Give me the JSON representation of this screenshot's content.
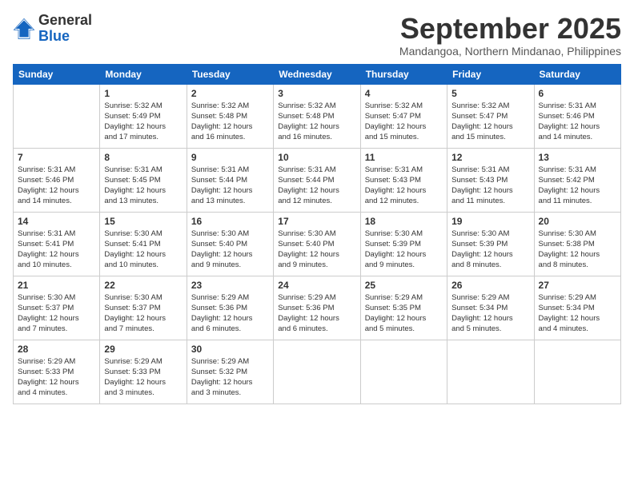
{
  "logo": {
    "general": "General",
    "blue": "Blue"
  },
  "header": {
    "month": "September 2025",
    "location": "Mandangoa, Northern Mindanao, Philippines"
  },
  "weekdays": [
    "Sunday",
    "Monday",
    "Tuesday",
    "Wednesday",
    "Thursday",
    "Friday",
    "Saturday"
  ],
  "weeks": [
    [
      {
        "day": "",
        "info": ""
      },
      {
        "day": "1",
        "info": "Sunrise: 5:32 AM\nSunset: 5:49 PM\nDaylight: 12 hours\nand 17 minutes."
      },
      {
        "day": "2",
        "info": "Sunrise: 5:32 AM\nSunset: 5:48 PM\nDaylight: 12 hours\nand 16 minutes."
      },
      {
        "day": "3",
        "info": "Sunrise: 5:32 AM\nSunset: 5:48 PM\nDaylight: 12 hours\nand 16 minutes."
      },
      {
        "day": "4",
        "info": "Sunrise: 5:32 AM\nSunset: 5:47 PM\nDaylight: 12 hours\nand 15 minutes."
      },
      {
        "day": "5",
        "info": "Sunrise: 5:32 AM\nSunset: 5:47 PM\nDaylight: 12 hours\nand 15 minutes."
      },
      {
        "day": "6",
        "info": "Sunrise: 5:31 AM\nSunset: 5:46 PM\nDaylight: 12 hours\nand 14 minutes."
      }
    ],
    [
      {
        "day": "7",
        "info": "Sunrise: 5:31 AM\nSunset: 5:46 PM\nDaylight: 12 hours\nand 14 minutes."
      },
      {
        "day": "8",
        "info": "Sunrise: 5:31 AM\nSunset: 5:45 PM\nDaylight: 12 hours\nand 13 minutes."
      },
      {
        "day": "9",
        "info": "Sunrise: 5:31 AM\nSunset: 5:44 PM\nDaylight: 12 hours\nand 13 minutes."
      },
      {
        "day": "10",
        "info": "Sunrise: 5:31 AM\nSunset: 5:44 PM\nDaylight: 12 hours\nand 12 minutes."
      },
      {
        "day": "11",
        "info": "Sunrise: 5:31 AM\nSunset: 5:43 PM\nDaylight: 12 hours\nand 12 minutes."
      },
      {
        "day": "12",
        "info": "Sunrise: 5:31 AM\nSunset: 5:43 PM\nDaylight: 12 hours\nand 11 minutes."
      },
      {
        "day": "13",
        "info": "Sunrise: 5:31 AM\nSunset: 5:42 PM\nDaylight: 12 hours\nand 11 minutes."
      }
    ],
    [
      {
        "day": "14",
        "info": "Sunrise: 5:31 AM\nSunset: 5:41 PM\nDaylight: 12 hours\nand 10 minutes."
      },
      {
        "day": "15",
        "info": "Sunrise: 5:30 AM\nSunset: 5:41 PM\nDaylight: 12 hours\nand 10 minutes."
      },
      {
        "day": "16",
        "info": "Sunrise: 5:30 AM\nSunset: 5:40 PM\nDaylight: 12 hours\nand 9 minutes."
      },
      {
        "day": "17",
        "info": "Sunrise: 5:30 AM\nSunset: 5:40 PM\nDaylight: 12 hours\nand 9 minutes."
      },
      {
        "day": "18",
        "info": "Sunrise: 5:30 AM\nSunset: 5:39 PM\nDaylight: 12 hours\nand 9 minutes."
      },
      {
        "day": "19",
        "info": "Sunrise: 5:30 AM\nSunset: 5:39 PM\nDaylight: 12 hours\nand 8 minutes."
      },
      {
        "day": "20",
        "info": "Sunrise: 5:30 AM\nSunset: 5:38 PM\nDaylight: 12 hours\nand 8 minutes."
      }
    ],
    [
      {
        "day": "21",
        "info": "Sunrise: 5:30 AM\nSunset: 5:37 PM\nDaylight: 12 hours\nand 7 minutes."
      },
      {
        "day": "22",
        "info": "Sunrise: 5:30 AM\nSunset: 5:37 PM\nDaylight: 12 hours\nand 7 minutes."
      },
      {
        "day": "23",
        "info": "Sunrise: 5:29 AM\nSunset: 5:36 PM\nDaylight: 12 hours\nand 6 minutes."
      },
      {
        "day": "24",
        "info": "Sunrise: 5:29 AM\nSunset: 5:36 PM\nDaylight: 12 hours\nand 6 minutes."
      },
      {
        "day": "25",
        "info": "Sunrise: 5:29 AM\nSunset: 5:35 PM\nDaylight: 12 hours\nand 5 minutes."
      },
      {
        "day": "26",
        "info": "Sunrise: 5:29 AM\nSunset: 5:34 PM\nDaylight: 12 hours\nand 5 minutes."
      },
      {
        "day": "27",
        "info": "Sunrise: 5:29 AM\nSunset: 5:34 PM\nDaylight: 12 hours\nand 4 minutes."
      }
    ],
    [
      {
        "day": "28",
        "info": "Sunrise: 5:29 AM\nSunset: 5:33 PM\nDaylight: 12 hours\nand 4 minutes."
      },
      {
        "day": "29",
        "info": "Sunrise: 5:29 AM\nSunset: 5:33 PM\nDaylight: 12 hours\nand 3 minutes."
      },
      {
        "day": "30",
        "info": "Sunrise: 5:29 AM\nSunset: 5:32 PM\nDaylight: 12 hours\nand 3 minutes."
      },
      {
        "day": "",
        "info": ""
      },
      {
        "day": "",
        "info": ""
      },
      {
        "day": "",
        "info": ""
      },
      {
        "day": "",
        "info": ""
      }
    ]
  ]
}
